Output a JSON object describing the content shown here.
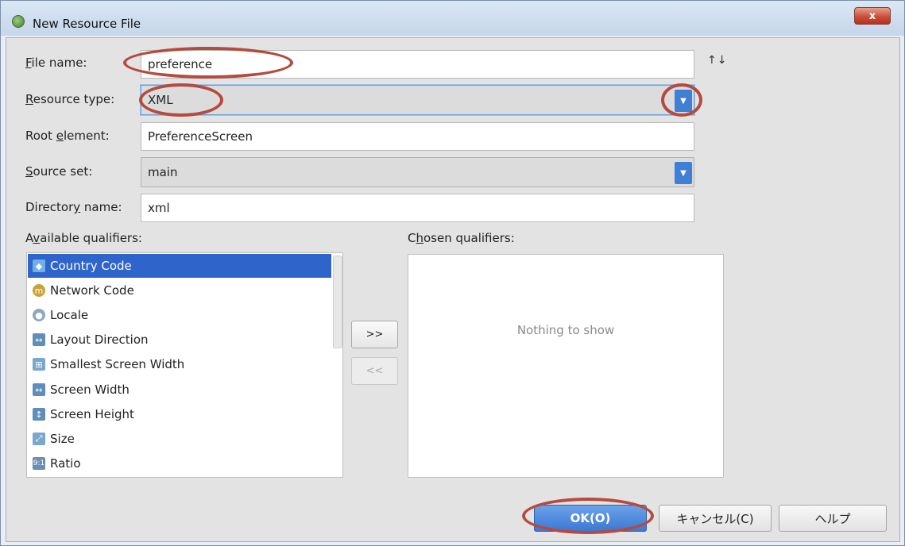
{
  "window": {
    "title": "New Resource File",
    "close_label": "x"
  },
  "form": {
    "file_name": {
      "label_prefix": "",
      "label_mnemonic": "F",
      "label_rest": "ile name:",
      "value": "preference"
    },
    "resource_type": {
      "label_mnemonic": "R",
      "label_rest": "esource type:",
      "value": "XML"
    },
    "root_element": {
      "label_before": "Root ",
      "label_mnemonic": "e",
      "label_rest": "lement:",
      "value": "PreferenceScreen"
    },
    "source_set": {
      "label_mnemonic": "S",
      "label_rest": "ource set:",
      "value": "main"
    },
    "directory_name": {
      "label_before": "Director",
      "label_mnemonic": "y",
      "label_rest": " name:",
      "value": "xml"
    },
    "sort_icon": "↑↓"
  },
  "available": {
    "label_before": "A",
    "label_mnemonic": "v",
    "label_rest": "ailable qualifiers:",
    "items": [
      {
        "label": "Country Code",
        "icon": "country-code-icon",
        "selected": true
      },
      {
        "label": "Network Code",
        "icon": "network-code-icon",
        "selected": false
      },
      {
        "label": "Locale",
        "icon": "locale-icon",
        "selected": false
      },
      {
        "label": "Layout Direction",
        "icon": "layout-direction-icon",
        "selected": false
      },
      {
        "label": "Smallest Screen Width",
        "icon": "smallest-screen-width-icon",
        "selected": false
      },
      {
        "label": "Screen Width",
        "icon": "screen-width-icon",
        "selected": false
      },
      {
        "label": "Screen Height",
        "icon": "screen-height-icon",
        "selected": false
      },
      {
        "label": "Size",
        "icon": "size-icon",
        "selected": false
      },
      {
        "label": "Ratio",
        "icon": "ratio-icon",
        "selected": false
      }
    ]
  },
  "chosen": {
    "label_before": "C",
    "label_mnemonic": "h",
    "label_rest": "osen qualifiers:",
    "empty_text": "Nothing to show"
  },
  "move": {
    "add": ">>",
    "remove": "<<"
  },
  "buttons": {
    "ok": "OK(O)",
    "cancel": "キャンセル(C)",
    "help": "ヘルプ"
  }
}
